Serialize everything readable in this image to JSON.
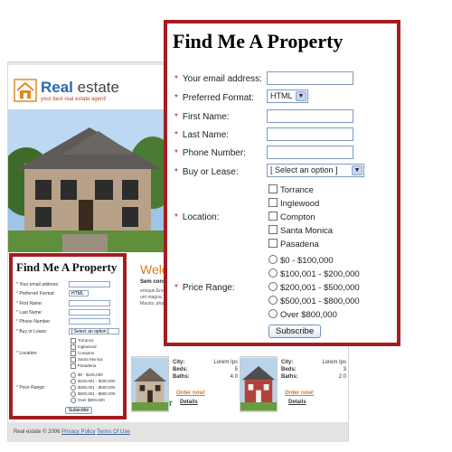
{
  "site": {
    "logo_brand": "Real",
    "logo_brand_rest": " estate",
    "logo_tagline": "your best real estate agent!",
    "welcome": "Welco",
    "intro_heading": "Sem conse",
    "intro_text": [
      "erisque.Eros",
      "unt magna.",
      "Mauris, pha"
    ],
    "our_text": "Our",
    "listings": [
      {
        "city_label": "City:",
        "city": "Lorem Ips",
        "beds_label": "Beds:",
        "beds": "5",
        "baths_label": "Baths:",
        "baths": "4.0",
        "order": "Order now!",
        "details": "Details"
      },
      {
        "city_label": "City:",
        "city": "Lorem Ips",
        "beds_label": "Beds:",
        "beds": "3",
        "baths_label": "Baths:",
        "baths": "2.0",
        "order": "Order now!",
        "details": "Details"
      }
    ],
    "footer_copyright": "Real estate © 2006",
    "footer_privacy": "Privacy Policy",
    "footer_terms": "Terms Of Use"
  },
  "form": {
    "title": "Find Me A Property",
    "required_marker": "*",
    "email_label": "Your email address:",
    "format_label": "Preferred Format:",
    "format_value": "HTML",
    "first_name_label": "First Name:",
    "last_name_label": "Last Name:",
    "phone_label": "Phone Number:",
    "buy_lease_label": "Buy or Lease:",
    "buy_lease_value": "[ Select an option ]",
    "location_label": "Location:",
    "locations": [
      "Torrance",
      "Inglewood",
      "Compton",
      "Santa Monica",
      "Pasadena"
    ],
    "price_label": "Price Range:",
    "prices": [
      "$0 - $100,000",
      "$100,001 - $200,000",
      "$200,001 - $500,000",
      "$500,001 - $800,000",
      "Over $800,000"
    ],
    "submit_label": "Subscribe"
  },
  "colors": {
    "highlight_border": "#a31e21",
    "brand_blue": "#2b67b2",
    "welcome_orange": "#e07a1e",
    "order_orange": "#e0731c"
  },
  "icons": {
    "logo": "house-logo-icon",
    "dropdown": "chevron-down-icon",
    "our_section": "tools-icon"
  }
}
